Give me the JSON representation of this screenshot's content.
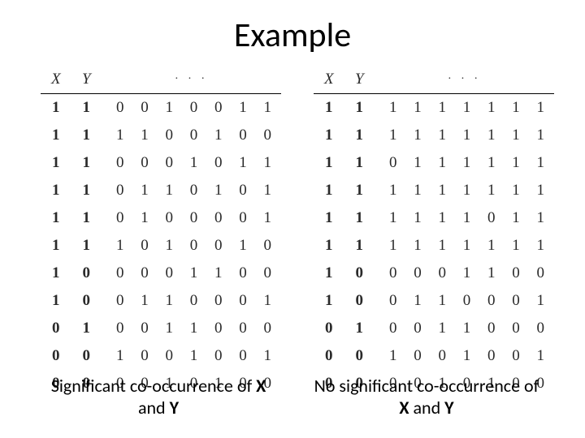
{
  "title": "Example",
  "headers": {
    "x": "X",
    "y": "Y",
    "rest": "· · ·"
  },
  "left": {
    "rows": [
      {
        "x": "1",
        "y": "1",
        "bits": "0 0 1 0 0 1 1"
      },
      {
        "x": "1",
        "y": "1",
        "bits": "1 1 0 0 1 0 0"
      },
      {
        "x": "1",
        "y": "1",
        "bits": "0 0 0 1 0 1 1"
      },
      {
        "x": "1",
        "y": "1",
        "bits": "0 1 1 0 1 0 1"
      },
      {
        "x": "1",
        "y": "1",
        "bits": "0 1 0 0 0 0 1"
      },
      {
        "x": "1",
        "y": "1",
        "bits": "1 0 1 0 0 1 0"
      },
      {
        "x": "1",
        "y": "0",
        "bits": "0 0 0 1 1 0 0"
      },
      {
        "x": "1",
        "y": "0",
        "bits": "0 1 1 0 0 0 1"
      },
      {
        "x": "0",
        "y": "1",
        "bits": "0 0 1 1 0 0 0"
      },
      {
        "x": "0",
        "y": "0",
        "bits": "1 0 0 1 0 0 1"
      },
      {
        "x": "0",
        "y": "0",
        "bits": "0 0 1 0 1 0 0"
      }
    ],
    "caption_pre": "Significant co-occurrence of ",
    "caption_x": "X",
    "caption_mid": " and ",
    "caption_y": "Y"
  },
  "right": {
    "rows": [
      {
        "x": "1",
        "y": "1",
        "bits": "1 1 1 1 1 1 1"
      },
      {
        "x": "1",
        "y": "1",
        "bits": "1 1 1 1 1 1 1"
      },
      {
        "x": "1",
        "y": "1",
        "bits": "0 1 1 1 1 1 1"
      },
      {
        "x": "1",
        "y": "1",
        "bits": "1 1 1 1 1 1 1"
      },
      {
        "x": "1",
        "y": "1",
        "bits": "1 1 1 1 0 1 1"
      },
      {
        "x": "1",
        "y": "1",
        "bits": "1 1 1 1 1 1 1"
      },
      {
        "x": "1",
        "y": "0",
        "bits": "0 0 0 1 1 0 0"
      },
      {
        "x": "1",
        "y": "0",
        "bits": "0 1 1 0 0 0 1"
      },
      {
        "x": "0",
        "y": "1",
        "bits": "0 0 1 1 0 0 0"
      },
      {
        "x": "0",
        "y": "0",
        "bits": "1 0 0 1 0 0 1"
      },
      {
        "x": "0",
        "y": "0",
        "bits": "0 0 1 0 1 0 0"
      }
    ],
    "caption_pre": "No significant co-occurrence of ",
    "caption_x": "X",
    "caption_mid": " and ",
    "caption_y": "Y"
  }
}
